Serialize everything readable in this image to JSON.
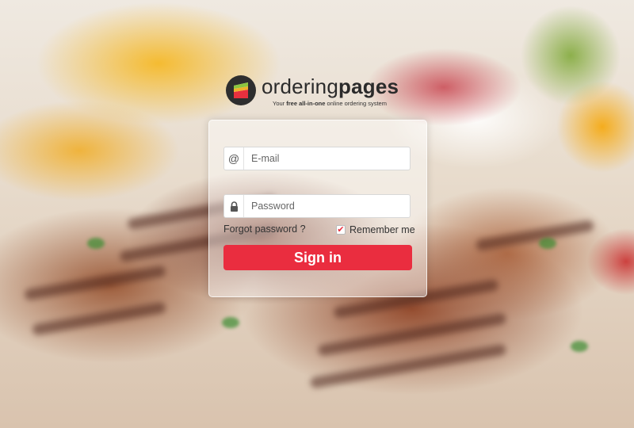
{
  "brand": {
    "name_regular": "ordering",
    "name_bold": "pages",
    "tagline_prefix": "Your ",
    "tagline_bold": "free all-in-one",
    "tagline_suffix": " online ordering system",
    "logo_icon": "ordering-pages-logo-icon"
  },
  "login": {
    "email_placeholder": "E-mail",
    "email_value": "",
    "email_icon": "at-icon",
    "password_placeholder": "Password",
    "password_value": "",
    "password_icon": "lock-icon",
    "forgot_label": "Forgot password ?",
    "remember_label": "Remember me",
    "remember_checked": true,
    "signin_label": "Sign in"
  },
  "colors": {
    "accent": "#ea2d3f",
    "text": "#333333"
  }
}
